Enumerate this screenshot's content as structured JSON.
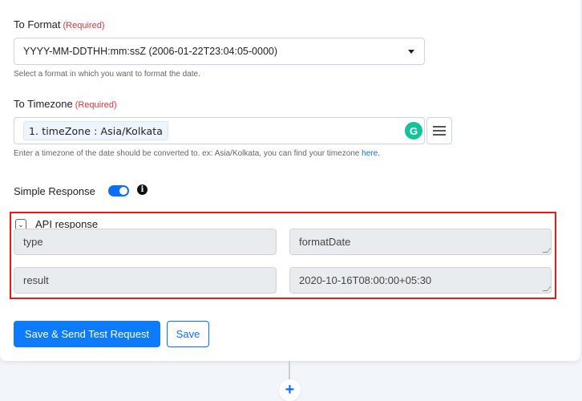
{
  "to_format": {
    "label": "To Format",
    "required": "(Required)",
    "selected": "YYYY-MM-DDTHH:mm:ssZ (2006-01-22T23:04:05-0000)",
    "hint": "Select a format in which you want to format the date."
  },
  "to_timezone": {
    "label": "To Timezone",
    "required": "(Required)",
    "chip": "1. timeZone : Asia/Kolkata",
    "grammarly_glyph": "G",
    "hint_prefix": "Enter a timezone of the date should be converted to. ex: Asia/Kolkata, you can find your timezone ",
    "hint_link": "here",
    "hint_suffix": "."
  },
  "simple_response": {
    "label": "Simple Response",
    "enabled": true,
    "info_glyph": "i"
  },
  "api_response": {
    "title": "API response",
    "chevron_glyph": "⌄",
    "rows": [
      {
        "key": "type",
        "value": "formatDate"
      },
      {
        "key": "result",
        "value": "2020-10-16T08:00:00+05:30"
      }
    ]
  },
  "actions": {
    "save_send_label": "Save & Send Test Request",
    "save_label": "Save"
  },
  "flow": {
    "add_glyph": "+"
  },
  "colors": {
    "accent": "#0d6efd",
    "required": "#d9363e",
    "highlight_border": "#e31c1c",
    "grammarly": "#15c39a"
  }
}
